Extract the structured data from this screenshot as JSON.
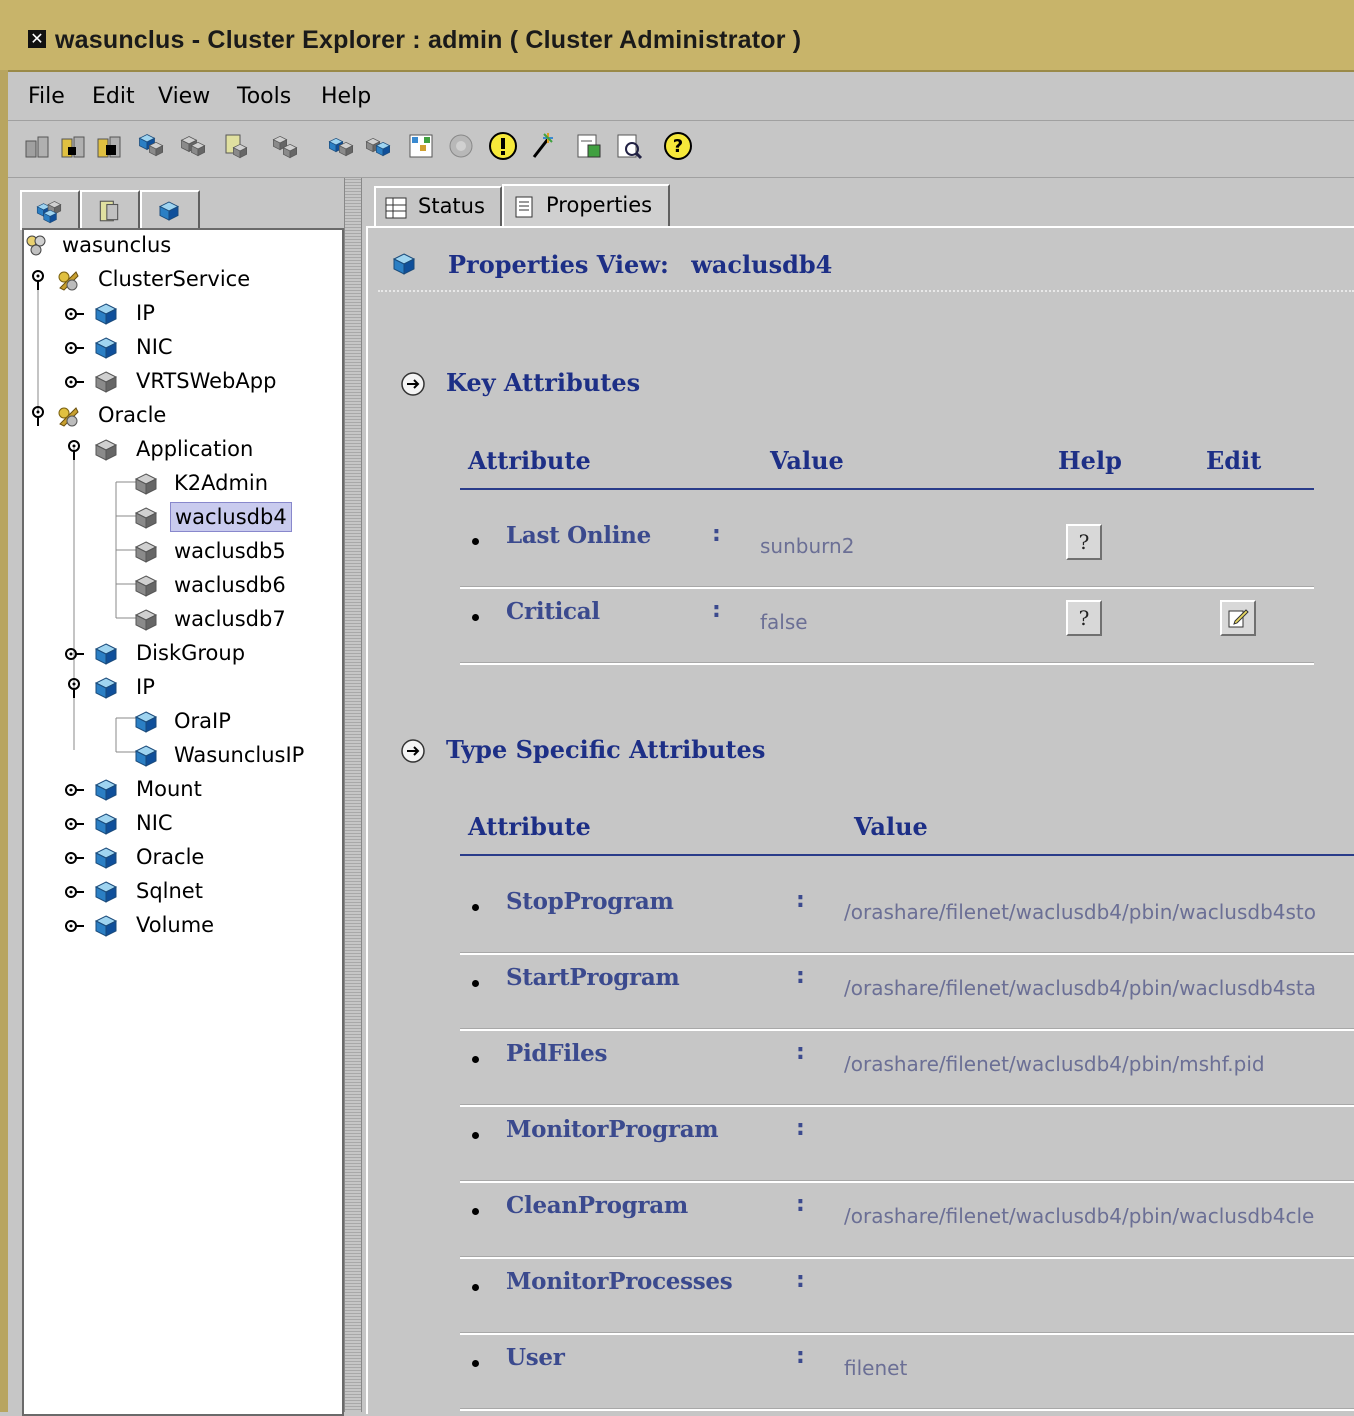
{
  "window": {
    "title": "wasunclus - Cluster Explorer : admin ( Cluster Administrator )",
    "close_glyph": "✕"
  },
  "menu": [
    {
      "label": "File"
    },
    {
      "label": "Edit"
    },
    {
      "label": "View"
    },
    {
      "label": "Tools"
    },
    {
      "label": "Help"
    }
  ],
  "toolbar": {
    "icons": [
      "add-system-icon",
      "add-service-group-icon",
      "delete-system-icon",
      "add-resource-icon",
      "link-resource-icon",
      "import-icon",
      "disabled-resource-icon",
      "online-icon",
      "offline-icon",
      "grid-icon",
      "disabled-icon",
      "alert-icon",
      "wizard-icon",
      "report-icon",
      "query-icon",
      "help-icon"
    ]
  },
  "left_tabs": [
    "service-groups-tab-icon",
    "systems-tab-icon",
    "resource-types-tab-icon"
  ],
  "tree": {
    "root": "wasunclus",
    "nodes": [
      {
        "label": "ClusterService"
      },
      {
        "label": "IP"
      },
      {
        "label": "NIC"
      },
      {
        "label": "VRTSWebApp"
      },
      {
        "label": "Oracle"
      },
      {
        "label": "Application"
      },
      {
        "label": "K2Admin"
      },
      {
        "label": "waclusdb4"
      },
      {
        "label": "waclusdb5"
      },
      {
        "label": "waclusdb6"
      },
      {
        "label": "waclusdb7"
      },
      {
        "label": "DiskGroup"
      },
      {
        "label": "IP"
      },
      {
        "label": "OraIP"
      },
      {
        "label": "WasunclusIP"
      },
      {
        "label": "Mount"
      },
      {
        "label": "NIC"
      },
      {
        "label": "Oracle"
      },
      {
        "label": "Sqlnet"
      },
      {
        "label": "Volume"
      }
    ],
    "selected": "waclusdb4"
  },
  "right_tabs": [
    {
      "label": "Status"
    },
    {
      "label": "Properties"
    }
  ],
  "properties": {
    "view_label": "Properties View:",
    "resource_name": "waclusdb4",
    "key_section": {
      "title": "Key Attributes",
      "headers": {
        "attribute": "Attribute",
        "value": "Value",
        "help": "Help",
        "edit": "Edit"
      },
      "rows": [
        {
          "name": "Last Online",
          "sep": ":",
          "value": "sunburn2"
        },
        {
          "name": "Critical",
          "sep": ":",
          "value": "false"
        }
      ]
    },
    "type_section": {
      "title": "Type Specific Attributes",
      "headers": {
        "attribute": "Attribute",
        "value": "Value"
      },
      "rows": [
        {
          "name": "StopProgram",
          "sep": ":",
          "value": "/orashare/filenet/waclusdb4/pbin/waclusdb4sto"
        },
        {
          "name": "StartProgram",
          "sep": ":",
          "value": "/orashare/filenet/waclusdb4/pbin/waclusdb4sta"
        },
        {
          "name": "PidFiles",
          "sep": ":",
          "value": "/orashare/filenet/waclusdb4/pbin/mshf.pid"
        },
        {
          "name": "MonitorProgram",
          "sep": ":",
          "value": ""
        },
        {
          "name": "CleanProgram",
          "sep": ":",
          "value": "/orashare/filenet/waclusdb4/pbin/waclusdb4cle"
        },
        {
          "name": "MonitorProcesses",
          "sep": ":",
          "value": ""
        },
        {
          "name": "User",
          "sep": ":",
          "value": "filenet"
        }
      ]
    }
  }
}
